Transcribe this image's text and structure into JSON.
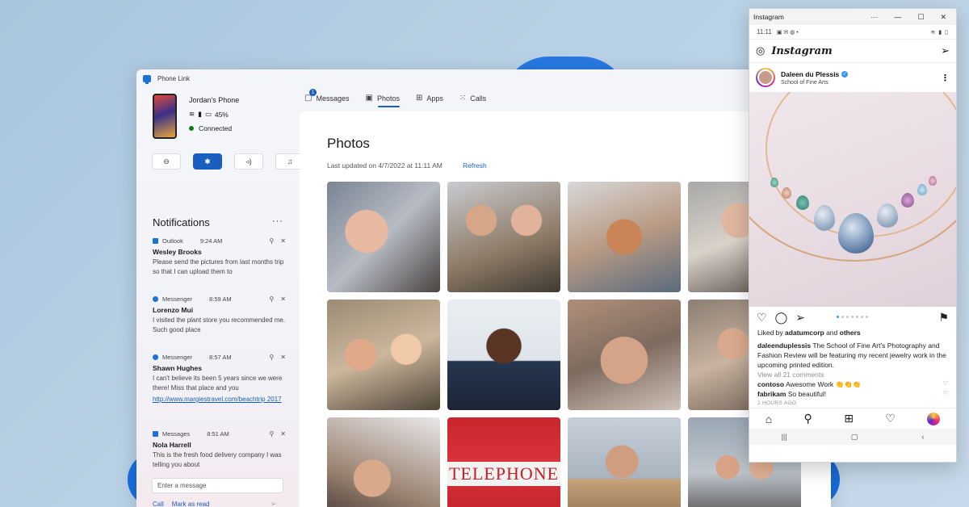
{
  "phone_link": {
    "window_title": "Phone Link",
    "device": {
      "name": "Jordan's Phone",
      "battery": "45%",
      "status": "Connected",
      "signal_icons": "wifi-signal-battery"
    },
    "quick_actions": [
      {
        "name": "do-not-disturb",
        "glyph": "⊖"
      },
      {
        "name": "bluetooth",
        "glyph": "✱"
      },
      {
        "name": "sound",
        "glyph": "◃)"
      },
      {
        "name": "music",
        "glyph": "♫"
      }
    ],
    "notifications": {
      "title": "Notifications",
      "more": "···",
      "items": [
        {
          "app": "Outlook",
          "time": "9:24 AM",
          "sender": "Wesley Brooks",
          "body": "Please send the pictures from last months trip so that I can upload them to"
        },
        {
          "app": "Messenger",
          "time": "8:59 AM",
          "sender": "Lorenzo Mui",
          "body": "I visited the plant store you recommended me. Such good place"
        },
        {
          "app": "Messenger",
          "time": "8:57 AM",
          "sender": "Shawn Hughes",
          "body": "I can't believe its been 5 years since we were there! Miss that place and you",
          "link": "http://www.margiestravel.com/beachtrip 2017"
        },
        {
          "app": "Messages",
          "time": "8:51 AM",
          "sender": "Nola Harrell",
          "body": "This is the fresh food delivery company I was telling you about"
        }
      ]
    },
    "message_input": {
      "placeholder": "Enter a message"
    },
    "message_actions": {
      "call": "Call",
      "mark_read": "Mark as read",
      "send": "➢"
    },
    "tabs": [
      {
        "label": "Messages",
        "badge": "1"
      },
      {
        "label": "Photos"
      },
      {
        "label": "Apps"
      },
      {
        "label": "Calls"
      }
    ],
    "photos": {
      "title": "Photos",
      "last_updated": "Last updated on 4/7/2022 at 11:11 AM",
      "refresh": "Refresh",
      "tile_text_telephone": "TELEPHONE"
    }
  },
  "instagram": {
    "window_title": "Instagram",
    "controls": {
      "more": "···",
      "minimize": "—",
      "maximize": "☐",
      "close": "✕"
    },
    "status_time": "11:11",
    "logo": "Instagram",
    "post": {
      "user": "Daleen du Plessis",
      "subtitle": "School of Fine Arts",
      "liked_by_prefix": "Liked by",
      "liked_by_user": "adatumcorp",
      "liked_by_suffix": "and",
      "liked_by_others": "others",
      "caption_user": "daleenduplessis",
      "caption": "The School of Fine Art's Photography and Fashion Review will be featuring my recent jewelry work in the upcoming printed edition.",
      "view_all": "View all 21 comments",
      "comments": [
        {
          "user": "contoso",
          "text": "Awesome Work 👏👏👏"
        },
        {
          "user": "fabrikam",
          "text": "So beautiful!"
        }
      ],
      "time_ago": "2 HOURS AGO"
    }
  }
}
